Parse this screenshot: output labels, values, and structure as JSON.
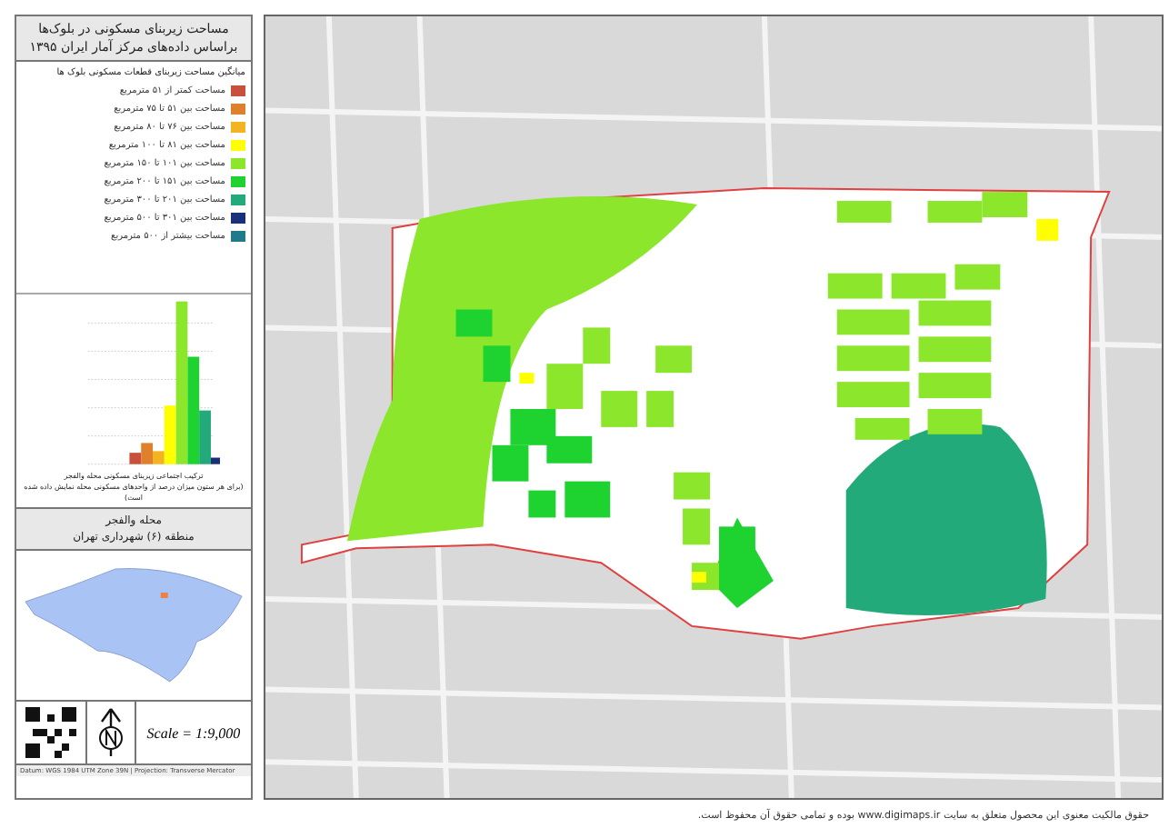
{
  "panel": {
    "title_lines": [
      "مساحت زیربنای مسکونی در بلوک‌ها",
      "براساس داده‌های مرکز آمار ایران ۱۳۹۵"
    ],
    "legend": {
      "heading": "میانگین مساحت زیربنای قطعات مسکونی بلوک ها",
      "items": [
        {
          "label": "مساحت کمتر از ۵۱ مترمربع",
          "color": "#c8503c"
        },
        {
          "label": "مساحت بین ۵۱ تا ۷۵ مترمربع",
          "color": "#e0802c"
        },
        {
          "label": "مساحت بین ۷۶ تا ۸۰ مترمربع",
          "color": "#f2b421"
        },
        {
          "label": "مساحت بین ۸۱ تا ۱۰۰ مترمربع",
          "color": "#ffff00"
        },
        {
          "label": "مساحت بین ۱۰۱ تا ۱۵۰ مترمربع",
          "color": "#8ce62b"
        },
        {
          "label": "مساحت بین ۱۵۱ تا ۲۰۰ مترمربع",
          "color": "#1ed230"
        },
        {
          "label": "مساحت بین ۲۰۱ تا ۳۰۰ مترمربع",
          "color": "#22aa7a"
        },
        {
          "label": "مساحت بین ۳۰۱ تا ۵۰۰ مترمربع",
          "color": "#1a2f7a"
        },
        {
          "label": "مساحت بیشتر از ۵۰۰ مترمربع",
          "color": "#1f7b8a"
        }
      ]
    },
    "chart_caption": [
      "ترکیب اجتماعی زیربنای مسکونی محله والفجر",
      "(برای هر ستون میزان درصد از واحدهای مسکونی محله نمایش داده شده است)"
    ],
    "neighborhood": "محله والفجر",
    "district": "منطقه (۶) شهرداری تهران",
    "scale": "Scale = 1:9,000",
    "credit": "Datum: WGS 1984 UTM Zone 39N | Projection: Transverse Mercator"
  },
  "footer": "حقوق مالکیت معنوی این محصول متعلق به سایت www.digimaps.ir بوده و تمامی حقوق آن محفوظ است."
}
